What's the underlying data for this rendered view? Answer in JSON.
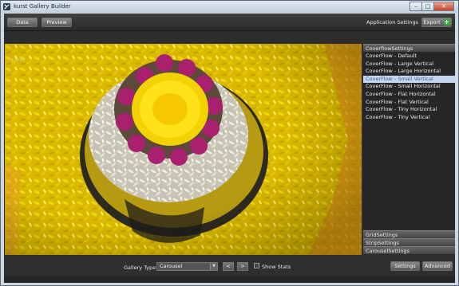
{
  "window": {
    "title": "kurst Gallery Builder",
    "controls": {
      "minimize": "–",
      "maximize": "□",
      "close": "✕"
    }
  },
  "toolbar": {
    "data_label": "Data",
    "preview_label": "Preview",
    "app_settings_label": "Application Settings",
    "export_label": "Export",
    "export_icon": "+"
  },
  "preview": {
    "image_description_icon": "flower-rangoli-image",
    "watermark": "kurst"
  },
  "panel": {
    "sections": [
      {
        "header": "CoverflowSettings",
        "expanded": true
      },
      {
        "header": "GridSettings",
        "expanded": false
      },
      {
        "header": "StripSettings",
        "expanded": false
      },
      {
        "header": "CarouselSettings",
        "expanded": false
      }
    ],
    "coverflow_items": [
      "CoverFlow - Default",
      "CoverFlow - Large Vertical",
      "CoverFlow - Large Horizontal",
      "CoverFlow - Small Vertical",
      "CoverFlow - Small Horizontal",
      "CoverFlow - Flat Horizontal",
      "CoverFlow - Flat Vertical",
      "CoverFlow - Tiny Horizontal",
      "CoverFlow - Tiny Vertical"
    ],
    "selected_index": 3
  },
  "bottom": {
    "gallery_type_label": "Gallery Type",
    "gallery_type_value": "Carousel",
    "prev_label": "<",
    "next_label": ">",
    "show_stats_label": "Show Stats",
    "show_stats_checked": false,
    "settings_label": "Settings",
    "advanced_label": "Advanced"
  },
  "colors": {
    "selection_bg": "#c4d7ef",
    "app_background": "#2d2d2d",
    "export_icon_green": "#3aa845"
  }
}
